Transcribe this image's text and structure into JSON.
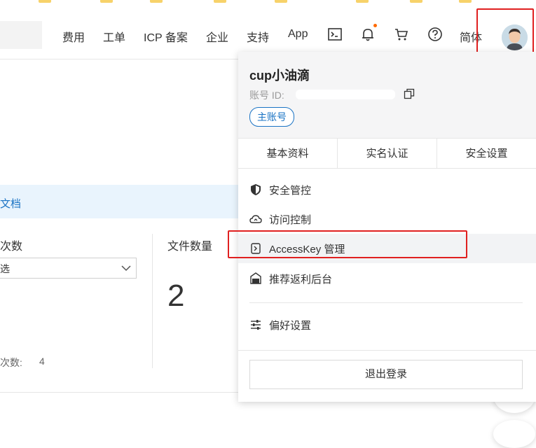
{
  "nav": {
    "items": [
      "费用",
      "工单",
      "ICP 备案",
      "企业",
      "支持",
      "App"
    ],
    "lang": "简体",
    "icons": [
      "terminal-icon",
      "bell-icon",
      "cart-icon",
      "help-icon"
    ]
  },
  "background": {
    "link_text": "文档",
    "label_visits": "次数",
    "select_value": "选",
    "label_files": "文件数量",
    "files_value": "2",
    "count_label": "次数:",
    "count_value": "4"
  },
  "account": {
    "username": "cup小油滴",
    "id_label": "账号 ID:",
    "badge": "主账号"
  },
  "tabs": [
    "基本资料",
    "实名认证",
    "安全设置"
  ],
  "menu": [
    {
      "label": "安全管控",
      "icon": "shield-icon"
    },
    {
      "label": "访问控制",
      "icon": "cloud-icon"
    },
    {
      "label": "AccessKey 管理",
      "icon": "key-icon"
    },
    {
      "label": "推荐返利后台",
      "icon": "gift-icon"
    },
    {
      "label": "偏好设置",
      "icon": "sliders-icon"
    }
  ],
  "logout_label": "退出登录",
  "colors": {
    "accent": "#1a73c4",
    "highlight": "#e02020",
    "notification": "#ff6a00"
  }
}
